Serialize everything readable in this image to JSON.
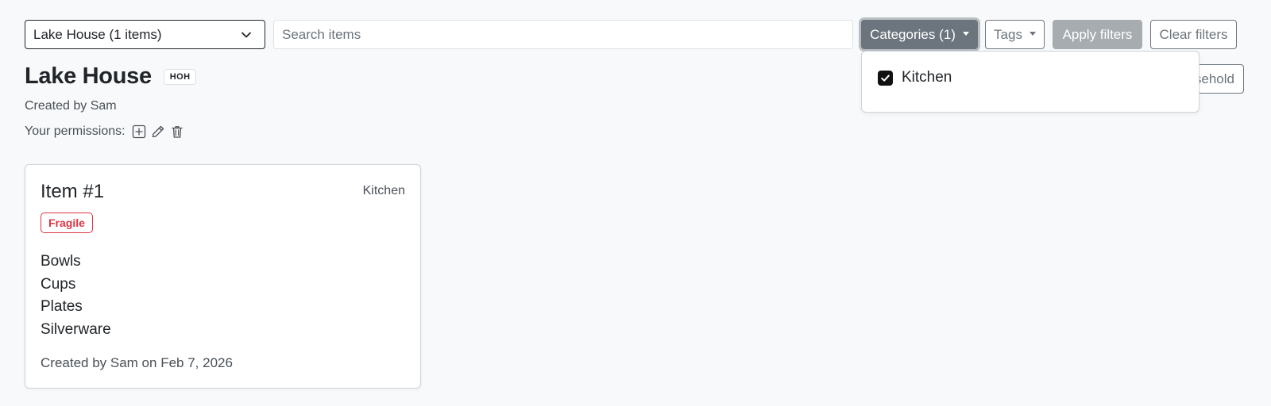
{
  "toolbar": {
    "household_select_value": "Lake House (1 items)",
    "search_placeholder": "Search items",
    "categories_label": "Categories (1)",
    "tags_label": "Tags",
    "apply_label": "Apply filters",
    "clear_label": "Clear filters"
  },
  "categories_dropdown": {
    "items": [
      {
        "label": "Kitchen",
        "checked": true
      }
    ]
  },
  "household": {
    "title": "Lake House",
    "badge": "HOH",
    "created_by": "Created by Sam",
    "permissions_label": "Your permissions:",
    "permission_icons": [
      "plus-square-icon",
      "pencil-icon",
      "trash-icon"
    ],
    "action_button_label_visible": "sehold"
  },
  "items": [
    {
      "title": "Item #1",
      "category": "Kitchen",
      "tag": "Fragile",
      "contents": [
        "Bowls",
        "Cups",
        "Plates",
        "Silverware"
      ],
      "footer": "Created by Sam on Feb 7, 2026"
    }
  ],
  "colors": {
    "secondary": "#6c757d",
    "danger": "#dc3545",
    "page_bg": "#f8f9fa"
  }
}
